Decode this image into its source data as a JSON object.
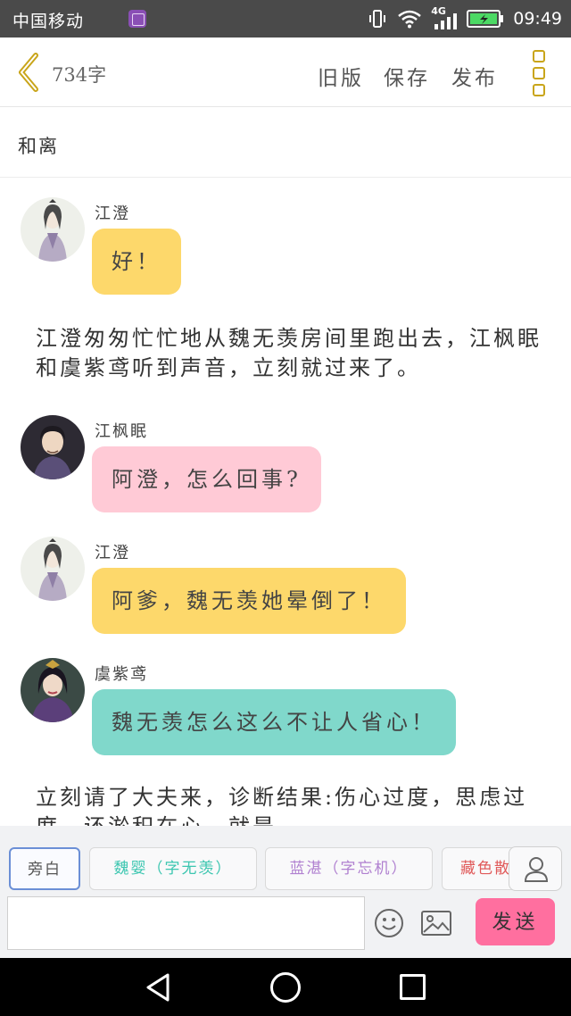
{
  "status_bar": {
    "carrier": "中国移动",
    "network": "4G",
    "time": "09:49",
    "icons": [
      "app-notification-icon",
      "vibrate-icon",
      "wifi-icon",
      "signal-icon",
      "battery-charging-icon"
    ]
  },
  "header": {
    "word_count": "734字",
    "actions": {
      "old_version": "旧版",
      "save": "保存",
      "publish": "发布"
    },
    "icons": [
      "chevron-left-icon",
      "more-menu-icon"
    ]
  },
  "story": {
    "title": "和离"
  },
  "messages": [
    {
      "type": "dialogue",
      "speaker": "江澄",
      "text": "好！",
      "bubble_color": "#fdd86b"
    },
    {
      "type": "narration",
      "text": "江澄匆匆忙忙地从魏无羡房间里跑出去，江枫眠和虞紫鸢听到声音，立刻就过来了。"
    },
    {
      "type": "dialogue",
      "speaker": "江枫眠",
      "text": "阿澄，怎么回事?",
      "bubble_color": "#ffcad6"
    },
    {
      "type": "dialogue",
      "speaker": "江澄",
      "text": "阿爹，魏无羡她晕倒了！",
      "bubble_color": "#fdd86b"
    },
    {
      "type": "dialogue",
      "speaker": "虞紫鸢",
      "text": "魏无羡怎么这么不让人省心！",
      "bubble_color": "#80d8cb"
    },
    {
      "type": "narration",
      "text": "立刻请了大夫来，诊断结果:伤心过度，思虑过度，还淤积在心，就是"
    }
  ],
  "character_bar": {
    "narration_chip": "旁白",
    "characters": [
      {
        "label": "魏婴（字无羡）",
        "color": "#3cc6b0"
      },
      {
        "label": "蓝湛（字忘机）",
        "color": "#b080d0"
      },
      {
        "label": "藏色散人",
        "color": "#e05a5a"
      }
    ],
    "input_placeholder": "",
    "send_label": "发送",
    "icons": [
      "user-icon",
      "emoji-icon",
      "image-icon"
    ]
  },
  "nav_bar": {
    "icons": [
      "back-triangle-icon",
      "home-circle-icon",
      "recent-square-icon"
    ]
  }
}
